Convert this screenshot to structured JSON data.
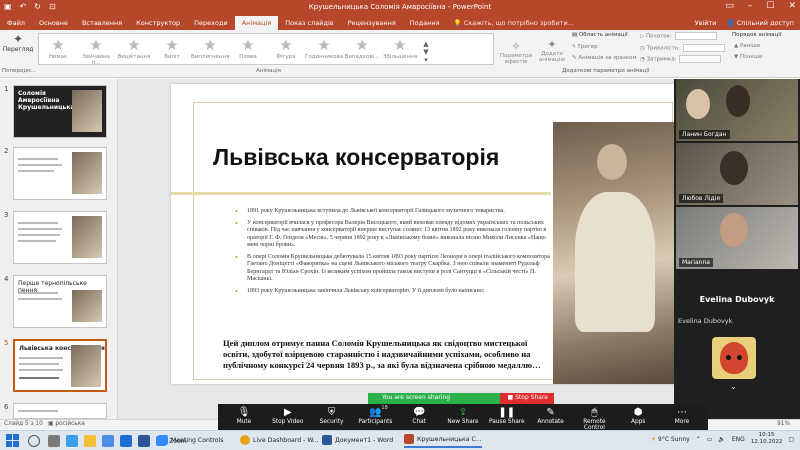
{
  "app": {
    "title": "Крушельницька Соломія Амвросіївна - PowerPoint",
    "sign_in": "Увійти",
    "share": "Спільний доступ"
  },
  "tabs": [
    "Файл",
    "Основне",
    "Вставлення",
    "Конструктор",
    "Переходи",
    "Анімація",
    "Показ слайдів",
    "Рецензування",
    "Подання"
  ],
  "active_tab": "Анімація",
  "tell_me": "Скажіть, що потрібно зробити...",
  "ribbon": {
    "preview": "Перегляд",
    "preview_group": "Попередн...",
    "animations": [
      "Немає",
      "Звичайна п...",
      "Вицвітання",
      "Виліт",
      "Виплигнення",
      "Поява",
      "Фігура",
      "Годинникова...",
      "Випадкові...",
      "Збільшення"
    ],
    "animation_group": "Анімація",
    "effect_options": "Параметри ефектів",
    "add_animation": "Додати анімацію",
    "animation_pane": "Область анімації",
    "trigger": "Тригер",
    "animation_painter": "Анімація за зразком",
    "advanced_group": "Додаткові параметри анімації",
    "start_label": "Початок:",
    "duration_label": "Тривалість:",
    "delay_label": "Затримка:",
    "reorder": "Порядок анімації",
    "move_earlier": "Раніше",
    "move_later": "Пізніше"
  },
  "thumbnails": [
    {
      "num": "1",
      "title": "Соломія Амвросіївна Крушельницька"
    },
    {
      "num": "2",
      "title": ""
    },
    {
      "num": "3",
      "title": ""
    },
    {
      "num": "4",
      "title": "Перше тернопільське пення"
    },
    {
      "num": "5",
      "title": "Львівська консерваторія"
    },
    {
      "num": "6",
      "title": ""
    }
  ],
  "slide": {
    "title": "Львівська консерваторія",
    "bullets": [
      "1891 року Крушельницька вступила до Львівської консерваторії Галицького музичного товариства.",
      "У консерваторії вчилася у професора Валерія Висоцького, який виховав плеяду відомих українських та польських співаків. Під час навчання у консерваторії вперше виступає соляно: 13 квітня 1892 року виконала головну партію в ораторії Г. Ф. Генделя «Месія». 5 червня 1892 року в «Львівському бояні» виконала пісню Миколи Лисенка «Нащо мені чорні брови».",
      "В опері Соломія Крушельницька дебютувала 15 квітня 1893 року партією Леонори в опері італійського композитора Гаетано Доніцетті «Фаворитка» на сцені Львівського міського театру Скарбка. З нею співали знамениті Рудольф Бернгардт та Юліан Єрохін. Із великим успіхом пройшла також виступи в ролі Сантуцці в «Сільській честі» П. Масканьї.",
      "1893 року Крушельницька закінчила Львівську консерваторію. У її дипломі було написано:"
    ],
    "quote": "Цей диплом отримує панна Соломія Крушельницька як свідоцтво мистецької освіти, здобутої взірцевою старанністю і надзвичайними успіхами, особливо на публічному конкурсі 24 червня 1893 р., за які була відзначена срібною медаллю…"
  },
  "participants": [
    {
      "name": "Ланин Богдан"
    },
    {
      "name": "Любов Лідія"
    },
    {
      "name": "Marianna"
    }
  ],
  "evelina": {
    "big_name": "Evelina Dubovyk",
    "footer": "Evelina Dubovyk"
  },
  "statusbar": {
    "slide_info": "Слайд 5 з 10",
    "language": "російська",
    "zoom": "91%"
  },
  "sharing": {
    "message": "You are screen sharing",
    "stop": "Stop Share"
  },
  "zoom_toolbar": [
    {
      "label": "Mute",
      "icon": "microphone-icon",
      "glyph": "🎙"
    },
    {
      "label": "Stop Video",
      "icon": "video-icon",
      "glyph": "▶"
    },
    {
      "label": "Security",
      "icon": "shield-icon",
      "glyph": "⛨"
    },
    {
      "label": "Participants",
      "icon": "participants-icon",
      "glyph": "👥",
      "count": "18"
    },
    {
      "label": "Chat",
      "icon": "chat-icon",
      "glyph": "💬"
    },
    {
      "label": "New Share",
      "icon": "share-icon",
      "glyph": "⇪"
    },
    {
      "label": "Pause Share",
      "icon": "pause-icon",
      "glyph": "❚❚"
    },
    {
      "label": "Annotate",
      "icon": "pencil-icon",
      "glyph": "✎"
    },
    {
      "label": "Remote Control",
      "icon": "remote-control-icon",
      "glyph": "🖱"
    },
    {
      "label": "Apps",
      "icon": "apps-icon",
      "glyph": "⬢"
    },
    {
      "label": "More",
      "icon": "more-icon",
      "glyph": "⋯"
    }
  ],
  "taskbar": {
    "apps": [
      {
        "label": "Zoom",
        "color": "#2d8cff"
      },
      {
        "label": "Meeting Controls",
        "color": "#2d8cff"
      },
      {
        "label": "Live Dashboard - W...",
        "color": "#e8a21a"
      },
      {
        "label": "Документ1 - Word",
        "color": "#2b579a"
      },
      {
        "label": "Крушельницька С...",
        "color": "#b7472a"
      }
    ],
    "weather": "9°C  Sunny",
    "lang": "ENG",
    "time": "10:15",
    "date": "12.10.2022"
  },
  "colors": {
    "accent": "#b7472a",
    "zoom_green": "#2bb14a",
    "zoom_red": "#e02d2d"
  }
}
